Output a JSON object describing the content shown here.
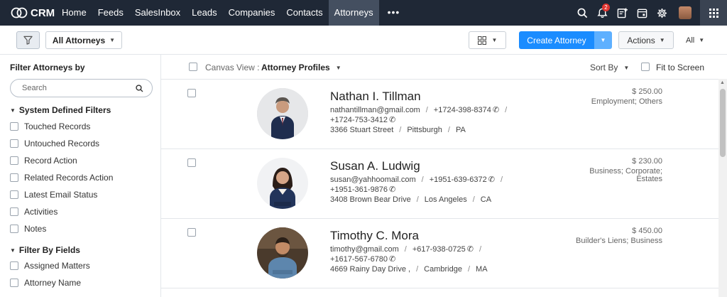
{
  "app": {
    "name": "CRM"
  },
  "nav": {
    "items": [
      "Home",
      "Feeds",
      "SalesInbox",
      "Leads",
      "Companies",
      "Contacts",
      "Attorneys"
    ],
    "active": "Attorneys",
    "more": "•••"
  },
  "notifications": {
    "count": "2"
  },
  "toolbar": {
    "view_label": "All Attorneys",
    "create_label": "Create Attorney",
    "actions_label": "Actions",
    "all_label": "All"
  },
  "sidebar": {
    "title": "Filter Attorneys by",
    "search_placeholder": "Search",
    "system_filters_title": "System Defined Filters",
    "system_filters": [
      "Touched Records",
      "Untouched Records",
      "Record Action",
      "Related Records Action",
      "Latest Email Status",
      "Activities",
      "Notes"
    ],
    "field_filters_title": "Filter By Fields",
    "field_filters": [
      "Assigned Matters",
      "Attorney Name"
    ]
  },
  "canvas": {
    "label": "Canvas View :",
    "value": "Attorney Profiles",
    "sort_label": "Sort By",
    "fit_label": "Fit to Screen"
  },
  "records": [
    {
      "name": "Nathan I. Tillman",
      "email": "nathantillman@gmail.com",
      "phone1": "+1724-398-8374",
      "phone2": "+1724-753-3412",
      "street": "3366 Stuart Street",
      "city": "Pittsburgh",
      "state": "PA",
      "amount": "$ 250.00",
      "category": "Employment; Others"
    },
    {
      "name": "Susan A. Ludwig",
      "email": "susan@yahhoomail.com",
      "phone1": "+1951-639-6372",
      "phone2": "+1951-361-9876",
      "street": "3408 Brown Bear Drive",
      "city": "Los Angeles",
      "state": "CA",
      "amount": "$ 230.00",
      "category": "Business; Corporate; Estates"
    },
    {
      "name": "Timothy C. Mora",
      "email": "timothy@gmail.com",
      "phone1": "+617-938-0725",
      "phone2": "+1617-567-6780",
      "street": "4669 Rainy Day Drive ,",
      "city": "Cambridge",
      "state": "MA",
      "amount": "$ 450.00",
      "category": "Builder's Liens; Business"
    }
  ]
}
